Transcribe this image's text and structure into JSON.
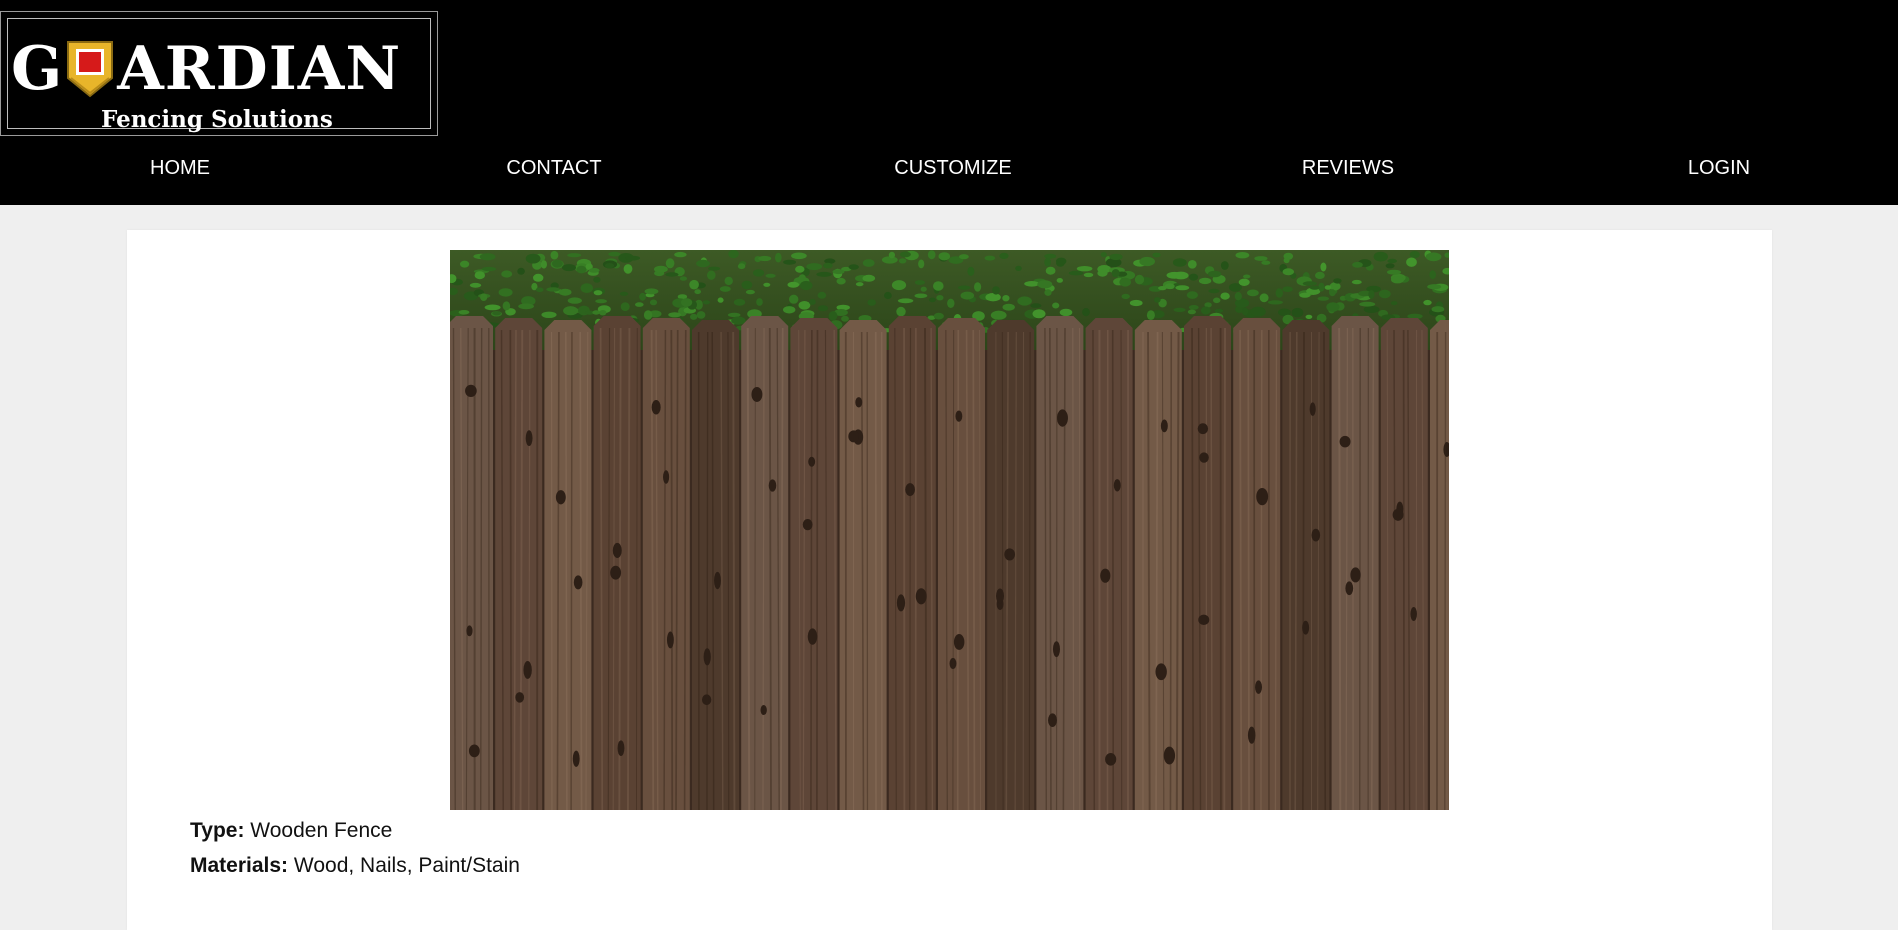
{
  "brand": {
    "name_before": "G",
    "name_after": "ARDIAN",
    "subtitle": "Fencing Solutions",
    "shield_colors": {
      "outer": "#e8b52a",
      "inner": "#d61a1a"
    }
  },
  "nav": {
    "items": [
      "HOME",
      "CONTACT",
      "CUSTOMIZE",
      "REVIEWS",
      "LOGIN"
    ]
  },
  "product": {
    "image_alt": "wooden fence with hedge above",
    "type_label": "Type:",
    "type_value": "Wooden Fence",
    "materials_label": "Materials:",
    "materials_value": "Wood, Nails, Paint/Stain"
  },
  "colors": {
    "header_bg": "#000000",
    "page_bg": "#efefef",
    "card_bg": "#ffffff"
  }
}
